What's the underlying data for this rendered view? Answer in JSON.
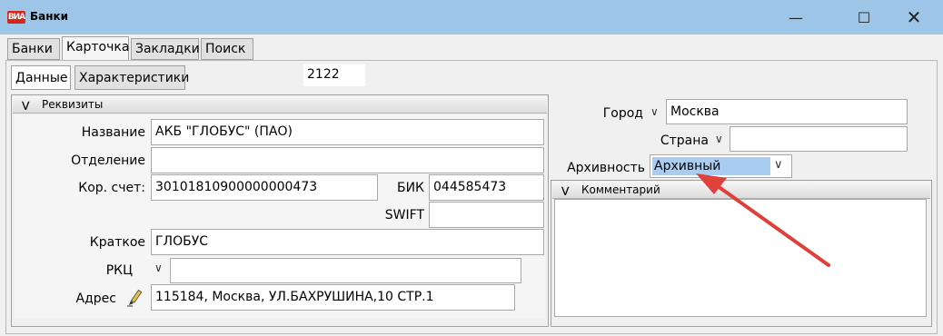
{
  "window": {
    "title": "Банки",
    "logo_text": "ВИА"
  },
  "tabs": [
    "Банки",
    "Карточка",
    "Закладки",
    "Поиск"
  ],
  "subtabs": [
    "Данные",
    "Характеристики"
  ],
  "record_id": "2122",
  "requisites": {
    "header": "Реквизиты",
    "name_label": "Название",
    "name_value": "АКБ \"ГЛОБУС\" (ПАО)",
    "branch_label": "Отделение",
    "branch_value": "",
    "corr_label": "Кор. счет:",
    "corr_value": "30101810900000000473",
    "bik_label": "БИК",
    "bik_value": "044585473",
    "swift_label": "SWIFT",
    "swift_value": "",
    "short_label": "Краткое",
    "short_value": "ГЛОБУС",
    "rkc_label": "РКЦ",
    "rkc_value": "",
    "address_label": "Адрес",
    "address_value": "115184, Москва, УЛ.БАХРУШИНА,10 СТР.1"
  },
  "right": {
    "city_label": "Город",
    "city_value": "Москва",
    "country_label": "Страна",
    "country_value": "",
    "archive_label": "Архивность",
    "archive_value": "Архивный",
    "comment_header": "Комментарий",
    "comment_value": ""
  },
  "colors": {
    "titlebar": "#9dc5e8",
    "selection": "#a8cdf0",
    "arrow": "#e0403a"
  }
}
